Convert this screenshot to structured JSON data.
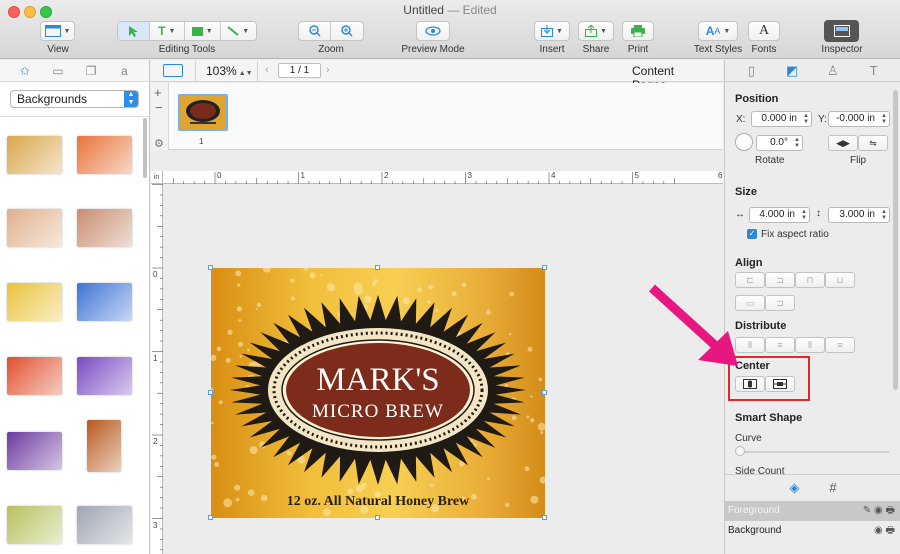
{
  "window": {
    "title": "Untitled",
    "edited": "— Edited"
  },
  "toolbar": {
    "view": "View",
    "editing_tools": "Editing Tools",
    "zoom": "Zoom",
    "preview_mode": "Preview Mode",
    "insert": "Insert",
    "share": "Share",
    "print": "Print",
    "text_styles": "Text Styles",
    "fonts": "Fonts",
    "inspector": "Inspector"
  },
  "sidebar": {
    "category": "Backgrounds",
    "thumbnails": [
      {
        "name": "bg-black-stroke",
        "color": "#d9a64b"
      },
      {
        "name": "bg-pink-stripes",
        "color": "#e8743a"
      },
      {
        "name": "bg-dots-orange",
        "color": "#e0b08a"
      },
      {
        "name": "bg-wood",
        "color": "#c98e72"
      },
      {
        "name": "bg-yellow-blue",
        "color": "#e8c23a"
      },
      {
        "name": "bg-blue-wash",
        "color": "#3f73d6"
      },
      {
        "name": "bg-red-orange",
        "color": "#e0502e"
      },
      {
        "name": "bg-purple-wash",
        "color": "#7a4bc4"
      },
      {
        "name": "bg-violet-orange",
        "color": "#6b3aa0"
      },
      {
        "name": "bg-sunset",
        "color": "#b8591e"
      },
      {
        "name": "bg-green-yellow",
        "color": "#b6c15e"
      },
      {
        "name": "bg-gray-wave",
        "color": "#9fa6b2"
      }
    ]
  },
  "canvas_bar": {
    "zoom": "103%",
    "page": "1 / 1",
    "view_mode": "Content Pages"
  },
  "pages": {
    "thumb_number": "1"
  },
  "ruler": {
    "unit": "in",
    "top_ticks": [
      "0",
      "1",
      "2",
      "3",
      "4",
      "5",
      "6"
    ],
    "left_ticks": [
      "0",
      "1",
      "2",
      "3"
    ]
  },
  "label": {
    "title": "MARK'S",
    "subtitle": "MICRO BREW",
    "footer": "12 oz. All Natural Honey Brew"
  },
  "inspector": {
    "position_title": "Position",
    "x_label": "X:",
    "x_value": "0.000 in",
    "y_label": "Y:",
    "y_value": "-0.000 in",
    "rotate_value": "0.0°",
    "rotate_label": "Rotate",
    "flip_label": "Flip",
    "size_title": "Size",
    "width_value": "4.000 in",
    "height_value": "3.000 in",
    "fix_aspect": "Fix aspect ratio",
    "align_title": "Align",
    "distribute_title": "Distribute",
    "center_title": "Center",
    "smart_shape_title": "Smart Shape",
    "curve_label": "Curve",
    "side_count_label": "Side Count",
    "layers": [
      {
        "name": "Foreground",
        "selected": true
      },
      {
        "name": "Background",
        "selected": false
      }
    ]
  },
  "colors": {
    "accent": "#2a8ad8",
    "highlight": "#e02a2a",
    "arrow": "#e8177f"
  }
}
